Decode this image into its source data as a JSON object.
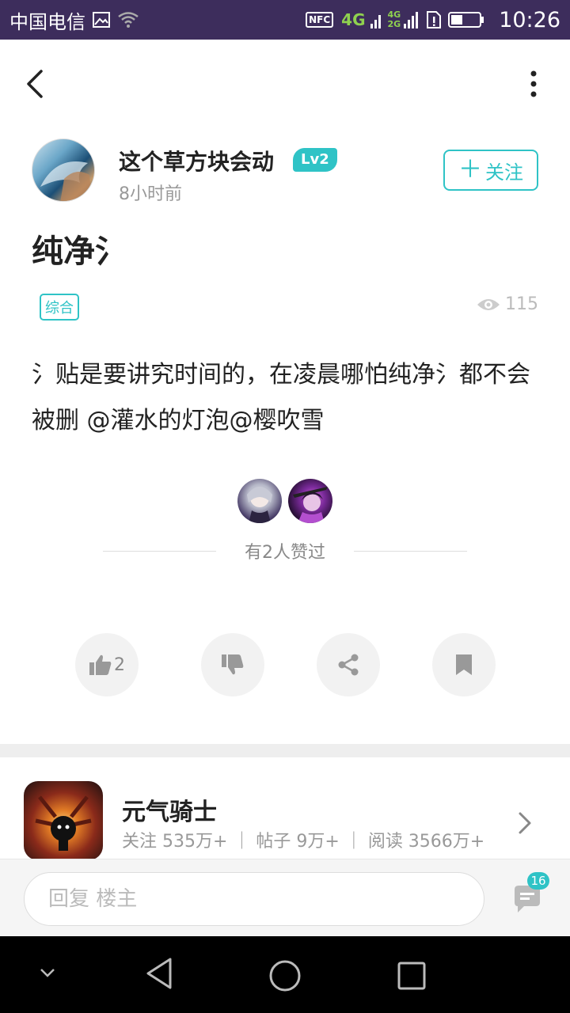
{
  "status_bar": {
    "carrier": "中国电信",
    "nfc": "NFC",
    "network": "4G",
    "network_alt_top": "4G",
    "network_alt_bottom": "2G",
    "time": "10:26"
  },
  "toolbar": {
    "back_icon": "chevron-left-icon",
    "more_icon": "more-vertical-icon"
  },
  "author": {
    "name": "这个草方块会动",
    "level": "Lv2",
    "time": "8小时前",
    "follow_label": "关注",
    "follow_plus": "＋"
  },
  "post": {
    "title": "纯净氵",
    "tag": "综合",
    "views": "115",
    "content": "氵贴是要讲究时间的，在凌晨哪怕纯净氵都不会被删 @灌水的灯泡@樱吹雪"
  },
  "likes": {
    "summary": "有2人赞过",
    "like_count": "2"
  },
  "game": {
    "name": "元气骑士",
    "stats": "关注 535万+ ｜ 帖子 9万+ ｜ 阅读 3566万+"
  },
  "reply": {
    "placeholder": "回复  楼主",
    "comment_count": "16"
  },
  "colors": {
    "accent": "#2fc3c6",
    "status_bar": "#3d2d5c"
  }
}
